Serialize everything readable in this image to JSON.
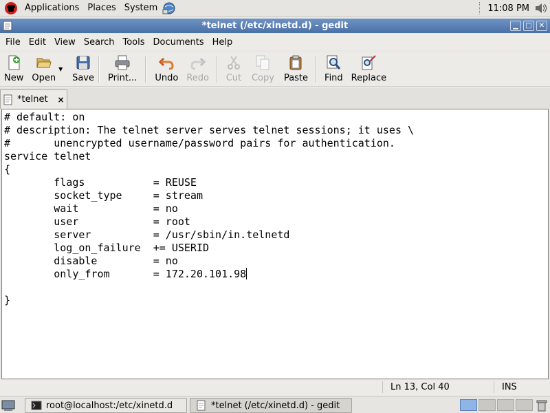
{
  "top_panel": {
    "menus": [
      "Applications",
      "Places",
      "System"
    ],
    "clock": "11:08 PM"
  },
  "window": {
    "title": "*telnet (/etc/xinetd.d) - gedit",
    "controls": [
      "minimize-icon",
      "maximize-icon",
      "close-icon"
    ]
  },
  "menubar": {
    "items": [
      {
        "label": "File"
      },
      {
        "label": "Edit"
      },
      {
        "label": "View"
      },
      {
        "label": "Search"
      },
      {
        "label": "Tools"
      },
      {
        "label": "Documents"
      },
      {
        "label": "Help"
      }
    ]
  },
  "toolbar": {
    "new": "New",
    "open": "Open",
    "save": "Save",
    "print": "Print...",
    "undo": "Undo",
    "redo": "Redo",
    "cut": "Cut",
    "copy": "Copy",
    "paste": "Paste",
    "find": "Find",
    "replace": "Replace",
    "disabled": [
      "Redo",
      "Cut",
      "Copy"
    ]
  },
  "tabs": [
    {
      "label": "*telnet",
      "close": "×"
    }
  ],
  "editor": {
    "lines": [
      "# default: on",
      "# description: The telnet server serves telnet sessions; it uses \\",
      "#\tunencrypted username/password pairs for authentication.",
      "service telnet",
      "{",
      "\tflags\t\t= REUSE",
      "\tsocket_type\t= stream",
      "\twait\t\t= no",
      "\tuser\t\t= root",
      "\tserver\t\t= /usr/sbin/in.telnetd",
      "\tlog_on_failure\t+= USERID",
      "\tdisable\t\t= no",
      "\tonly_from\t= 172.20.101.98",
      "",
      "}"
    ]
  },
  "statusbar": {
    "position": "Ln 13, Col 40",
    "mode": "INS"
  },
  "taskbar": {
    "tasks": [
      {
        "label": "root@localhost:/etc/xinetd.d",
        "active": false
      },
      {
        "label": "*telnet (/etc/xinetd.d) - gedit",
        "active": true
      }
    ],
    "workspaces": 4,
    "active_workspace": 1
  },
  "colors": {
    "titlebar": "#4a70a8",
    "panel": "#e6e5e1",
    "active_workspace": "#8fb5e6"
  }
}
